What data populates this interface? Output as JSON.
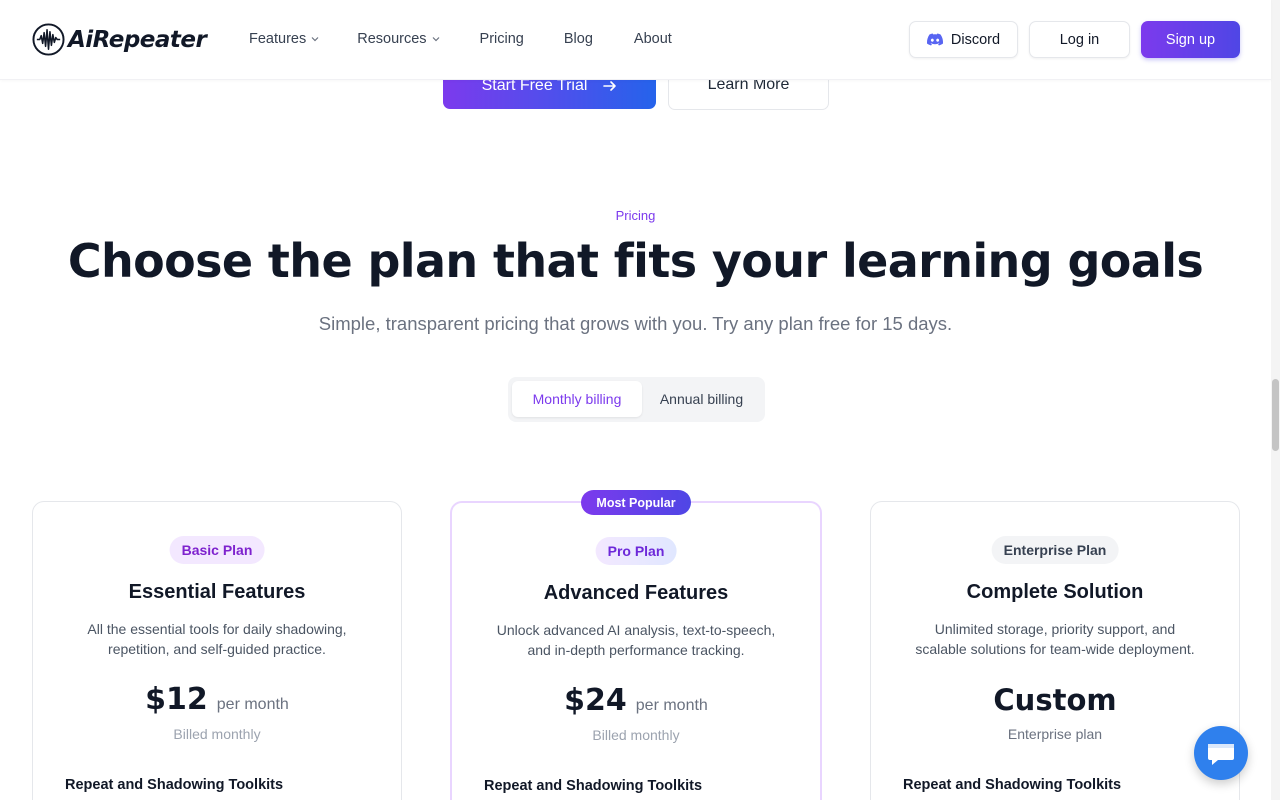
{
  "header": {
    "logo_text": "AiRepeater",
    "nav": [
      {
        "label": "Features",
        "has_dropdown": true
      },
      {
        "label": "Resources",
        "has_dropdown": true
      },
      {
        "label": "Pricing",
        "has_dropdown": false
      },
      {
        "label": "Blog",
        "has_dropdown": false
      },
      {
        "label": "About",
        "has_dropdown": false
      }
    ],
    "discord_label": "Discord",
    "login_label": "Log in",
    "signup_label": "Sign up"
  },
  "hero": {
    "trial_label": "Start Free Trial",
    "learn_label": "Learn More"
  },
  "pricing": {
    "eyebrow": "Pricing",
    "headline": "Choose the plan that fits your learning goals",
    "subhead": "Simple, transparent pricing that grows with you. Try any plan free for 15 days.",
    "billing_toggle": {
      "monthly": "Monthly billing",
      "annual": "Annual billing",
      "selected": "monthly"
    },
    "popular_badge": "Most Popular",
    "plans": [
      {
        "badge": "Basic Plan",
        "name": "Essential Features",
        "description": "All the essential tools for daily shadowing, repetition, and self-guided practice.",
        "price": "$12",
        "period": "per month",
        "billing_note": "Billed monthly",
        "first_feature": "Repeat and Shadowing Toolkits"
      },
      {
        "badge": "Pro Plan",
        "name": "Advanced Features",
        "description": "Unlock advanced AI analysis, text-to-speech, and in-depth performance tracking.",
        "price": "$24",
        "period": "per month",
        "billing_note": "Billed monthly",
        "first_feature": "Repeat and Shadowing Toolkits"
      },
      {
        "badge": "Enterprise Plan",
        "name": "Complete Solution",
        "description": "Unlimited storage, priority support, and scalable solutions for team-wide deployment.",
        "price": "Custom",
        "period": "",
        "billing_note": "Enterprise plan",
        "first_feature": "Repeat and Shadowing Toolkits"
      }
    ]
  },
  "colors": {
    "accent": "#7c3aed",
    "accent_blue": "#4f46e5",
    "heading": "#111827",
    "muted": "#6b7280",
    "chat": "#2f80ed"
  },
  "icons": {
    "logo": "soundwave-icon",
    "dropdown": "chevron-down-icon",
    "discord": "discord-icon",
    "arrow": "arrow-right-icon",
    "chat": "chat-bubble-icon"
  }
}
